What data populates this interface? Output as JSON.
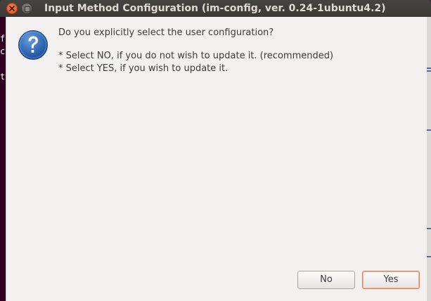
{
  "window": {
    "title": "Input Method Configuration (im-config, ver. 0.24-1ubuntu4.2)"
  },
  "background_terminal": {
    "chars": [
      "f",
      "c",
      "t"
    ]
  },
  "dialog": {
    "icon": "question-icon",
    "primary_text": "Do you explicitly select the user configuration?",
    "secondary_lines": [
      "* Select NO, if you do not wish to update it. (recommended)",
      "* Select YES, if you wish to update it."
    ],
    "buttons": {
      "no_label": "No",
      "yes_label": "Yes"
    }
  },
  "colors": {
    "titlebar": "#3c3b37",
    "close_button": "#e95420",
    "dialog_bg": "#f2f1f0",
    "icon_blue": "#3a6fb5",
    "default_button_border": "#e8785a"
  }
}
